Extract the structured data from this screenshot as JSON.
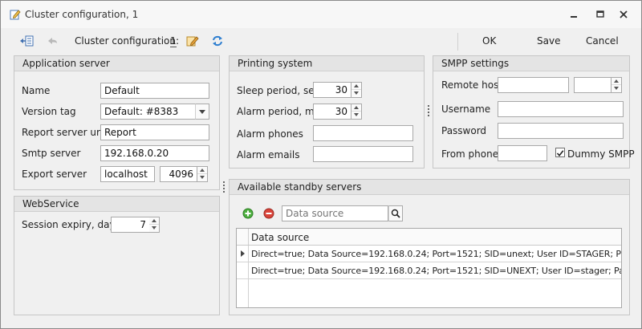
{
  "window": {
    "title": "Cluster configuration, 1"
  },
  "toolbar": {
    "title": "Cluster configuration:",
    "number": "1",
    "ok_label": "OK",
    "save_label": "Save",
    "cancel_label": "Cancel"
  },
  "app_server": {
    "header": "Application server",
    "name_label": "Name",
    "name_value": "Default",
    "version_label": "Version tag",
    "version_value": "Default: #8383",
    "report_label": "Report server url",
    "report_value": "Report",
    "smtp_label": "Smtp server",
    "smtp_value": "192.168.0.20",
    "export_label": "Export server",
    "export_host": "localhost",
    "export_port": "4096"
  },
  "webservice": {
    "header": "WebService",
    "session_label": "Session expiry, days",
    "session_value": "7"
  },
  "printing": {
    "header": "Printing system",
    "sleep_label": "Sleep period, sec.",
    "sleep_value": "30",
    "alarm_period_label": "Alarm period, min.",
    "alarm_period_value": "30",
    "alarm_phones_label": "Alarm phones",
    "alarm_phones_value": "",
    "alarm_emails_label": "Alarm emails",
    "alarm_emails_value": ""
  },
  "smpp": {
    "header": "SMPP settings",
    "remote_host_label": "Remote host",
    "remote_host_value": "",
    "remote_port_value": "",
    "username_label": "Username",
    "username_value": "",
    "password_label": "Password",
    "password_value": "",
    "from_phone_label": "From phone",
    "from_phone_value": "",
    "dummy_label": "Dummy SMPP",
    "dummy_checked": true
  },
  "standby": {
    "header": "Available standby servers",
    "search_placeholder": "Data source",
    "column_header": "Data source",
    "rows": [
      "Direct=true; Data Source=192.168.0.24; Port=1521; SID=unext; User ID=STAGER; Password=stager",
      "Direct=true; Data Source=192.168.0.24; Port=1521; SID=UNEXT; User ID=stager; Password=stager"
    ]
  },
  "colors": {
    "accent_orange": "#e8a33a",
    "add_green": "#4caf3e",
    "remove_red": "#d9443a",
    "refresh_blue": "#2f7fd0"
  },
  "icons": [
    "edit-icon",
    "minimize-icon",
    "restore-icon",
    "close-icon",
    "back-to-list-icon",
    "undo-icon",
    "rename-icon",
    "refresh-icon",
    "add-icon",
    "remove-icon",
    "search-icon",
    "row-indicator-icon"
  ]
}
